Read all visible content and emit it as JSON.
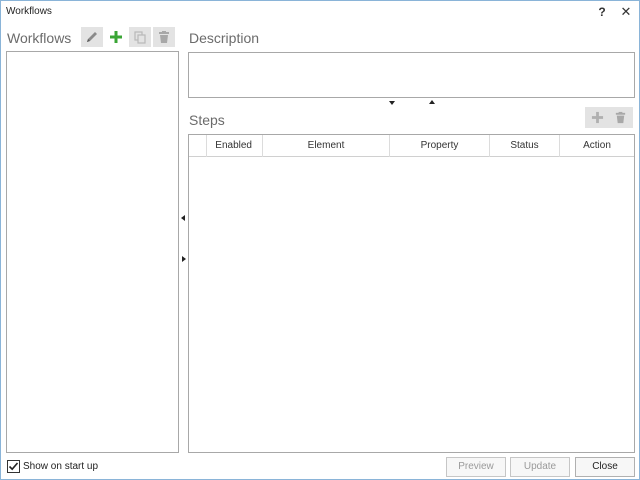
{
  "window": {
    "title": "Workflows",
    "help_label": "?",
    "close_label": "✕"
  },
  "workflows_pane": {
    "title": "Workflows",
    "toolbar": {
      "edit_icon": "pencil-icon",
      "add_icon": "plus-icon",
      "copy_icon": "copy-icon",
      "delete_icon": "trash-icon"
    },
    "items": []
  },
  "description": {
    "title": "Description",
    "value": ""
  },
  "steps": {
    "title": "Steps",
    "toolbar": {
      "add_icon": "plus-icon",
      "delete_icon": "trash-icon"
    },
    "columns": [
      "",
      "Enabled",
      "Element",
      "Property",
      "Status",
      "Action"
    ],
    "rows": []
  },
  "footer": {
    "show_on_startup_label": "Show on start up",
    "show_on_startup_checked": true,
    "preview_label": "Preview",
    "update_label": "Update",
    "close_label": "Close"
  },
  "colors": {
    "accent_green": "#3aa535",
    "disabled_gray": "#b8b8b8",
    "border": "#a8a8a8"
  }
}
